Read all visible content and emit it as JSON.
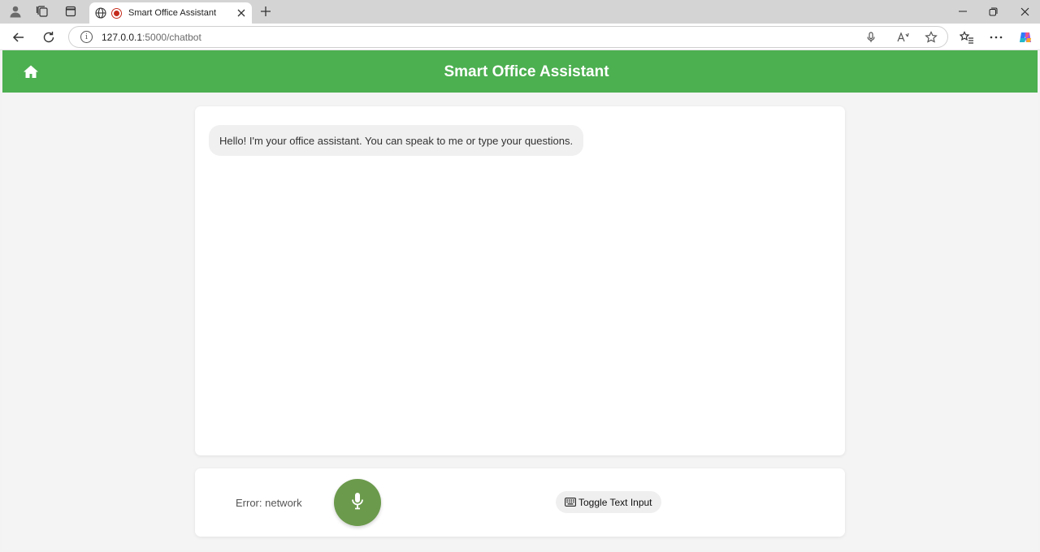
{
  "browser": {
    "tab_title": "Smart Office Assistant",
    "url_host": "127.0.0.1",
    "url_path": ":5000/chatbot",
    "icons": [
      "profile-icon",
      "workspaces-icon",
      "tab-actions-icon",
      "globe-icon",
      "recording-icon",
      "close-icon",
      "new-tab-icon",
      "minimize-icon",
      "restore-icon",
      "window-close-icon",
      "back-icon",
      "refresh-icon",
      "info-icon",
      "voice-search-icon",
      "read-aloud-icon",
      "favorite-star-icon",
      "favorites-icon",
      "more-icon",
      "copilot-icon"
    ]
  },
  "app": {
    "title": "Smart Office Assistant",
    "header_color": "#4caf50",
    "home_icon": "home-icon"
  },
  "chat": {
    "messages": [
      {
        "role": "assistant",
        "text": "Hello! I'm your office assistant. You can speak to me or type your questions."
      }
    ]
  },
  "controls": {
    "status_text": "Error: network",
    "mic_icon": "microphone-icon",
    "mic_color": "#6b9a4c",
    "toggle_label": "Toggle Text Input",
    "toggle_icon": "keyboard-icon"
  }
}
